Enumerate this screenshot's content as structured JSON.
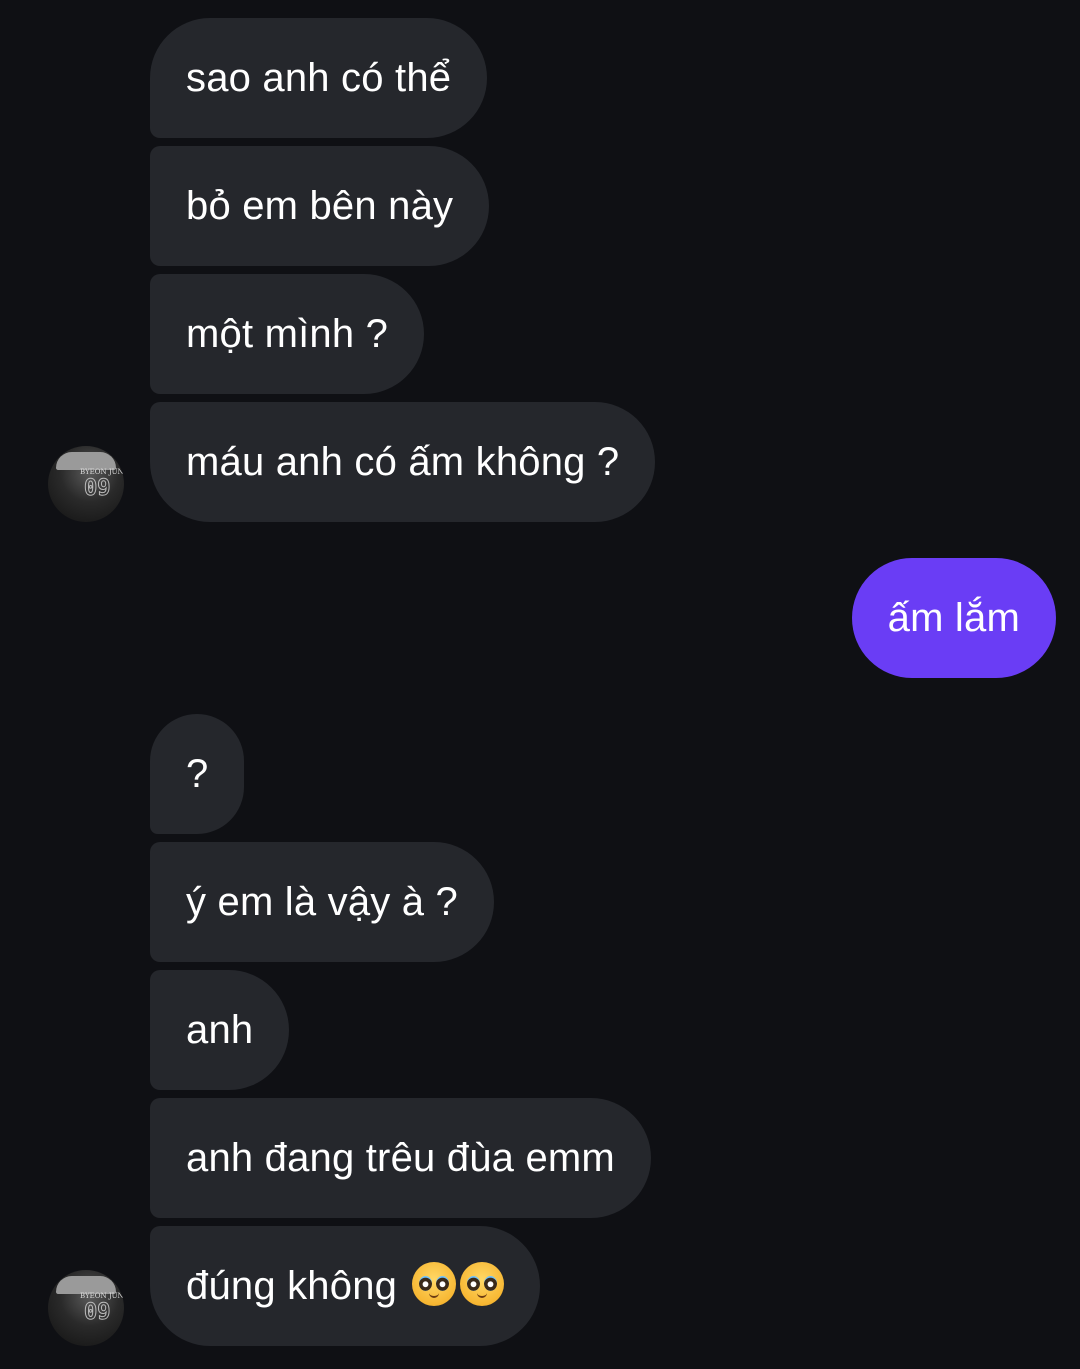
{
  "conversation": {
    "incoming_group_1": [
      {
        "text": "sao anh có thể"
      },
      {
        "text": "bỏ em bên này"
      },
      {
        "text": "một mình ?"
      },
      {
        "text": "máu anh có ấm không ?"
      }
    ],
    "outgoing": [
      {
        "text": "ấm lắm"
      }
    ],
    "incoming_group_2": [
      {
        "text": "?"
      },
      {
        "text": "ý em là vậy à ?"
      },
      {
        "text": "anh"
      },
      {
        "text": "anh đang trêu đùa emm"
      },
      {
        "text": "đúng không",
        "emoji": [
          "pleading-face",
          "pleading-face"
        ]
      }
    ]
  },
  "avatar": {
    "label": "BYEON JUN",
    "number": "09"
  },
  "colors": {
    "background": "#0f1014",
    "incoming_bubble": "#25272c",
    "outgoing_bubble": "#6a3df5",
    "text": "#ffffff"
  }
}
